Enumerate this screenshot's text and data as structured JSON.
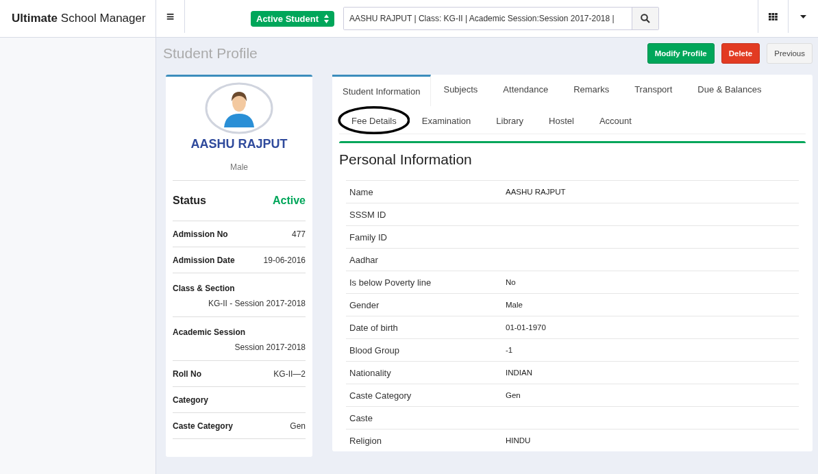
{
  "brand": {
    "bold": "Ultimate",
    "rest": "School Manager"
  },
  "topbar": {
    "menu_icon": "≡",
    "status_select": "Active Student",
    "search": {
      "value": "AASHU RAJPUT | Class: KG-II | Academic Session:Session 2017-2018 |"
    }
  },
  "page": {
    "title": "Student Profile",
    "buttons": [
      {
        "label": "Modify Profile",
        "kind": "success"
      },
      {
        "label": "Delete",
        "kind": "danger"
      },
      {
        "label": "Previous",
        "kind": "default"
      }
    ]
  },
  "profile": {
    "name": "AASHU RAJPUT",
    "gender": "Male",
    "status_label": "Status",
    "status_value": "Active",
    "fields": [
      {
        "label": "Admission No",
        "value": "477",
        "kind": "inline"
      },
      {
        "label": "Admission Date",
        "value": "19-06-2016",
        "kind": "inline"
      },
      {
        "label": "Class & Section",
        "value": "KG-II - Session 2017-2018",
        "kind": "stacked"
      },
      {
        "label": "Academic Session",
        "value": "Session 2017-2018",
        "kind": "stacked"
      },
      {
        "label": "Roll No",
        "value": "KG-II—2",
        "kind": "inline"
      },
      {
        "label": "Category",
        "kind": "inline"
      },
      {
        "label": "Caste Category",
        "value": "Gen",
        "kind": "inline"
      }
    ]
  },
  "tabs": [
    {
      "label": "Student Information",
      "selected": true,
      "circled": false
    },
    {
      "label": "Subjects",
      "selected": false,
      "circled": false
    },
    {
      "label": "Attendance",
      "selected": false,
      "circled": false
    },
    {
      "label": "Remarks",
      "selected": false,
      "circled": false
    },
    {
      "label": "Transport",
      "selected": false,
      "circled": false
    },
    {
      "label": "Due & Balances",
      "selected": false,
      "circled": false
    },
    {
      "label": "Fee Details",
      "selected": false,
      "circled": true
    },
    {
      "label": "Examination",
      "selected": false,
      "circled": false
    },
    {
      "label": "Library",
      "selected": false,
      "circled": false
    },
    {
      "label": "Hostel",
      "selected": false,
      "circled": false
    },
    {
      "label": "Account",
      "selected": false,
      "circled": false
    }
  ],
  "personal_information": {
    "title": "Personal Information",
    "rows": [
      {
        "label": "Name",
        "value": "AASHU RAJPUT"
      },
      {
        "label": "SSSM ID"
      },
      {
        "label": "Family ID"
      },
      {
        "label": "Aadhar"
      },
      {
        "label": "Is below Poverty line",
        "value": "No"
      },
      {
        "label": "Gender",
        "value": "Male"
      },
      {
        "label": "Date of birth",
        "value": "01-01-1970"
      },
      {
        "label": "Blood Group",
        "value": "-1"
      },
      {
        "label": "Nationality",
        "value": "INDIAN"
      },
      {
        "label": "Caste Category",
        "value": "Gen"
      },
      {
        "label": "Caste"
      },
      {
        "label": "Religion",
        "value": "HINDU"
      }
    ]
  }
}
